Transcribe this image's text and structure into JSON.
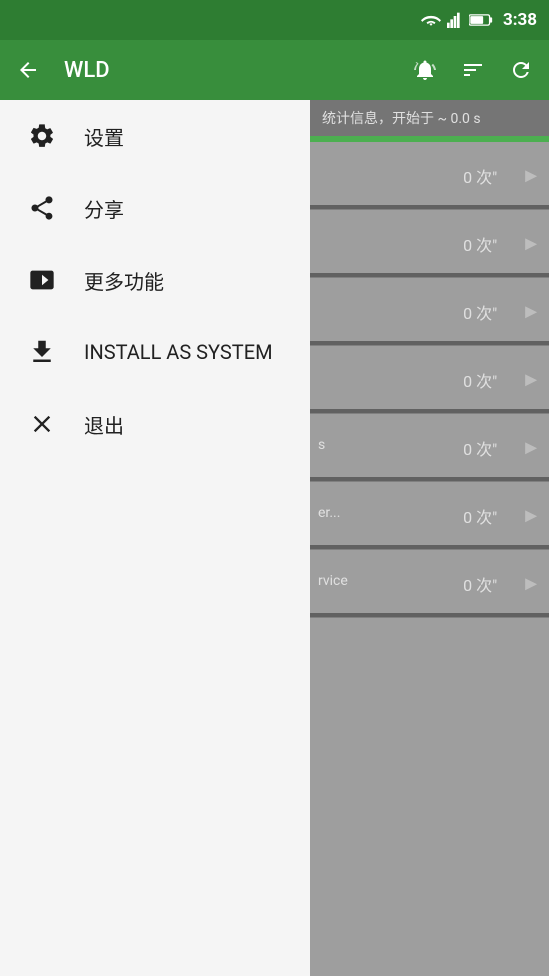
{
  "statusBar": {
    "time": "3:38"
  },
  "appBar": {
    "title": "WLD",
    "backLabel": "←",
    "alarmIcon": "alarm",
    "filterIcon": "filter",
    "refreshIcon": "refresh"
  },
  "menu": {
    "items": [
      {
        "id": "settings",
        "icon": "gear",
        "label": "设置"
      },
      {
        "id": "share",
        "icon": "share",
        "label": "分享"
      },
      {
        "id": "more",
        "icon": "play",
        "label": "更多功能"
      },
      {
        "id": "install",
        "icon": "download",
        "label": "INSTALL AS SYSTEM"
      },
      {
        "id": "exit",
        "icon": "close",
        "label": "退出"
      }
    ]
  },
  "rightPanel": {
    "header": "统计信息，开始于 ~ 0.0 s",
    "rows": [
      {
        "label": "",
        "count": "0 次\""
      },
      {
        "label": "",
        "count": "0 次\""
      },
      {
        "label": "",
        "count": "0 次\""
      },
      {
        "label": "",
        "count": "0 次\""
      },
      {
        "label": "s",
        "count": "0 次\""
      },
      {
        "label": "er...",
        "count": "0 次\""
      },
      {
        "label": "rvice",
        "count": "0 次\""
      }
    ]
  }
}
